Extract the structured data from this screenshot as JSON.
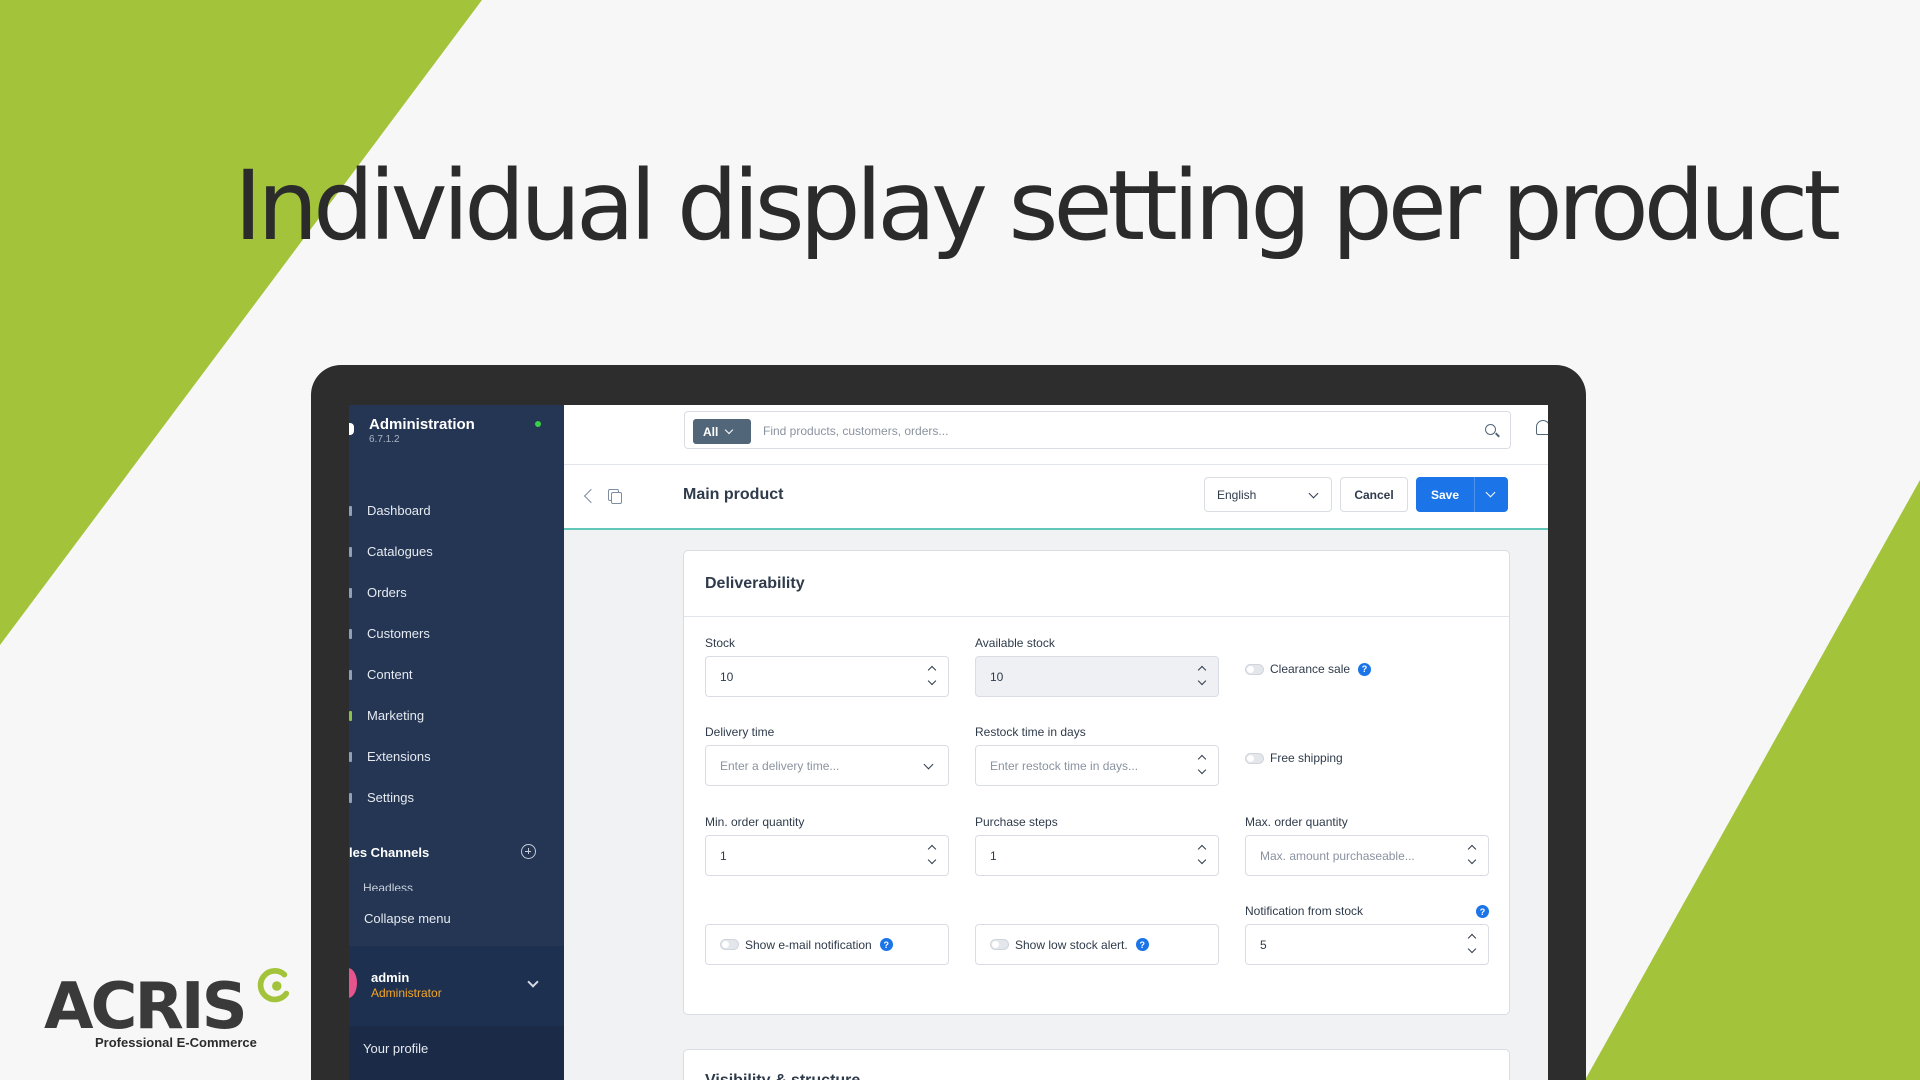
{
  "headline": "Individual display setting per product",
  "colors": {
    "accent_green": "#a3c43a",
    "sidebar": "#243654",
    "primary_blue": "#1b74e8"
  },
  "brand": {
    "name": "ACRIS",
    "tagline": "Professional E-Commerce"
  },
  "sidebar": {
    "title": "Administration",
    "version": "6.7.1.2",
    "items": [
      {
        "label": "Dashboard"
      },
      {
        "label": "Catalogues"
      },
      {
        "label": "Orders"
      },
      {
        "label": "Customers"
      },
      {
        "label": "Content"
      },
      {
        "label": "Marketing"
      },
      {
        "label": "Extensions"
      },
      {
        "label": "Settings"
      }
    ],
    "sales_channels_label": "les Channels",
    "headless_label": "Headless",
    "collapse_label": "Collapse menu",
    "user": {
      "name": "admin",
      "role": "Administrator"
    },
    "profile_label": "Your profile"
  },
  "search": {
    "scope": "All",
    "placeholder": "Find products, customers, orders..."
  },
  "actionbar": {
    "title": "Main product",
    "language": "English",
    "cancel_label": "Cancel",
    "save_label": "Save"
  },
  "deliverability": {
    "title": "Deliverability",
    "stock": {
      "label": "Stock",
      "value": "10"
    },
    "available_stock": {
      "label": "Available stock",
      "value": "10"
    },
    "clearance_sale": {
      "label": "Clearance sale"
    },
    "delivery_time": {
      "label": "Delivery time",
      "placeholder": "Enter a delivery time..."
    },
    "restock_time": {
      "label": "Restock time in days",
      "placeholder": "Enter restock time in days..."
    },
    "free_shipping": {
      "label": "Free shipping"
    },
    "min_order": {
      "label": "Min. order quantity",
      "value": "1"
    },
    "purchase_steps": {
      "label": "Purchase steps",
      "value": "1"
    },
    "max_order": {
      "label": "Max. order quantity",
      "placeholder": "Max. amount purchaseable..."
    },
    "email_notification": {
      "label": "Show e-mail notification"
    },
    "low_stock_alert": {
      "label": "Show low stock alert."
    },
    "notification_from_stock": {
      "label": "Notification from stock",
      "value": "5"
    }
  },
  "next_card_title": "Visibility & structure"
}
